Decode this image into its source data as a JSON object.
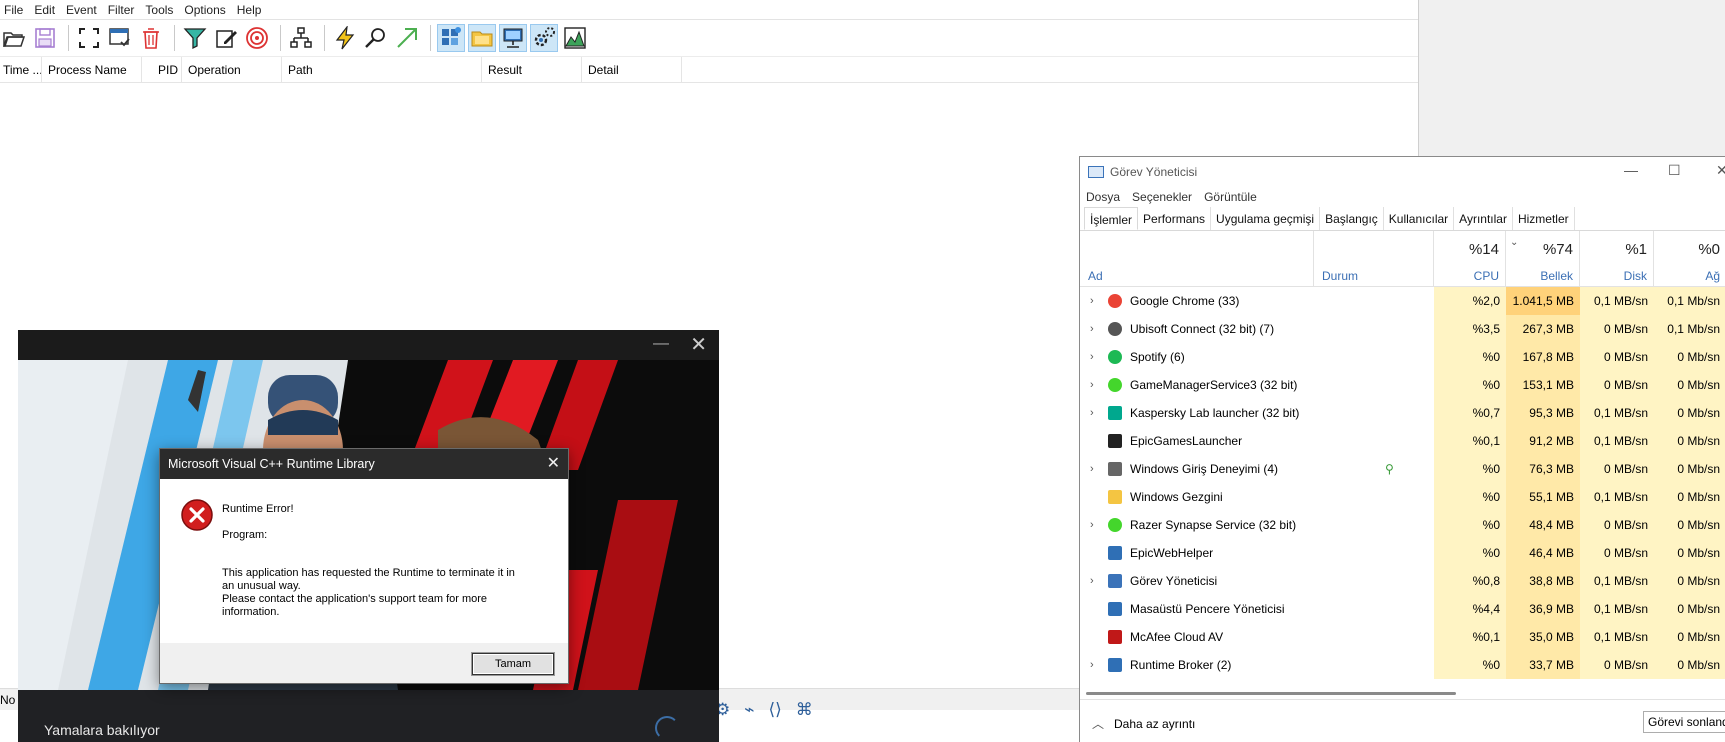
{
  "procmon": {
    "menu": [
      "File",
      "Edit",
      "Event",
      "Filter",
      "Tools",
      "Options",
      "Help"
    ],
    "toolbar_icons": [
      "open-icon",
      "save-icon",
      "autoscroll-icon",
      "capture-icon",
      "clear-icon",
      "filter-icon",
      "highlight-icon",
      "target-icon",
      "process-tree-icon",
      "event-icon",
      "find-icon",
      "jump-icon",
      "registry-icon",
      "filesystem-icon",
      "network-icon",
      "process-activity-icon",
      "profiling-icon"
    ],
    "columns": [
      "Time ...",
      "Process Name",
      "PID",
      "Operation",
      "Path",
      "Result",
      "Detail"
    ],
    "status": "No e"
  },
  "launcher": {
    "status": "Yamalara bakılıyor",
    "colors": {
      "bg": "#111111",
      "accent_red": "#d0121a",
      "accent_blue": "#3ea7e6"
    }
  },
  "dialog": {
    "title": "Microsoft Visual C++ Runtime Library",
    "heading": "Runtime Error!",
    "program_label": "Program:",
    "message_1": "This application has requested the Runtime to terminate it in",
    "message_2": "an unusual way.",
    "message_3": "Please contact the application's support team for more",
    "message_4": "information.",
    "ok_label": "Tamam"
  },
  "taskmgr": {
    "title": "Görev Yöneticisi",
    "menu": [
      "Dosya",
      "Seçenekler",
      "Görüntüle"
    ],
    "tabs": [
      "İşlemler",
      "Performans",
      "Uygulama geçmişi",
      "Başlangıç",
      "Kullanıcılar",
      "Ayrıntılar",
      "Hizmetler"
    ],
    "header": {
      "name": "Ad",
      "status": "Durum",
      "cpu_pct": "%14",
      "cpu": "CPU",
      "mem_pct": "%74",
      "mem": "Bellek",
      "disk_pct": "%1",
      "disk": "Disk",
      "net_pct": "%0",
      "net": "Ağ"
    },
    "rows": [
      {
        "name": "Google Chrome (33)",
        "cpu": "%2,0",
        "mem": "1.041,5 MB",
        "disk": "0,1 MB/sn",
        "net": "0,1 Mb/sn",
        "icon": "chrome-icon",
        "expand": true
      },
      {
        "name": "Ubisoft Connect (32 bit) (7)",
        "cpu": "%3,5",
        "mem": "267,3 MB",
        "disk": "0 MB/sn",
        "net": "0,1 Mb/sn",
        "icon": "ubisoft-icon",
        "expand": true
      },
      {
        "name": "Spotify (6)",
        "cpu": "%0",
        "mem": "167,8 MB",
        "disk": "0 MB/sn",
        "net": "0 Mb/sn",
        "icon": "spotify-icon",
        "expand": true
      },
      {
        "name": "GameManagerService3 (32 bit)",
        "cpu": "%0",
        "mem": "153,1 MB",
        "disk": "0 MB/sn",
        "net": "0 Mb/sn",
        "icon": "razer-icon",
        "expand": true
      },
      {
        "name": "Kaspersky Lab launcher (32 bit)",
        "cpu": "%0,7",
        "mem": "95,3 MB",
        "disk": "0,1 MB/sn",
        "net": "0 Mb/sn",
        "icon": "kaspersky-icon",
        "expand": true
      },
      {
        "name": "EpicGamesLauncher",
        "cpu": "%0,1",
        "mem": "91,2 MB",
        "disk": "0,1 MB/sn",
        "net": "0 Mb/sn",
        "icon": "epic-icon",
        "expand": false
      },
      {
        "name": "Windows Giriş Deneyimi (4)",
        "cpu": "%0",
        "mem": "76,3 MB",
        "disk": "0 MB/sn",
        "net": "0 Mb/sn",
        "icon": "keyboard-icon",
        "expand": true
      },
      {
        "name": "Windows Gezgini",
        "cpu": "%0",
        "mem": "55,1 MB",
        "disk": "0,1 MB/sn",
        "net": "0 Mb/sn",
        "icon": "folder-icon",
        "expand": false
      },
      {
        "name": "Razer Synapse Service (32 bit)",
        "cpu": "%0",
        "mem": "48,4 MB",
        "disk": "0 MB/sn",
        "net": "0 Mb/sn",
        "icon": "razer-icon",
        "expand": true
      },
      {
        "name": "EpicWebHelper",
        "cpu": "%0",
        "mem": "46,4 MB",
        "disk": "0 MB/sn",
        "net": "0 Mb/sn",
        "icon": "app-window-icon",
        "expand": false
      },
      {
        "name": "Görev Yöneticisi",
        "cpu": "%0,8",
        "mem": "38,8 MB",
        "disk": "0,1 MB/sn",
        "net": "0 Mb/sn",
        "icon": "taskmgr-icon",
        "expand": true
      },
      {
        "name": "Masaüstü Pencere Yöneticisi",
        "cpu": "%4,4",
        "mem": "36,9 MB",
        "disk": "0,1 MB/sn",
        "net": "0 Mb/sn",
        "icon": "app-window-icon",
        "expand": false
      },
      {
        "name": "McAfee Cloud AV",
        "cpu": "%0,1",
        "mem": "35,0 MB",
        "disk": "0,1 MB/sn",
        "net": "0 Mb/sn",
        "icon": "mcafee-icon",
        "expand": false
      },
      {
        "name": "Runtime Broker (2)",
        "cpu": "%0",
        "mem": "33,7 MB",
        "disk": "0 MB/sn",
        "net": "0 Mb/sn",
        "icon": "app-window-icon",
        "expand": true
      }
    ],
    "less_detail": "Daha az ayrıntı",
    "end_task": "Görevi sonland",
    "colors": {
      "heat_low": "#fff4c4",
      "heat_mid": "#ffe9a8",
      "heat_high": "#ffd27a",
      "header_blue": "#3b6fb4"
    }
  }
}
